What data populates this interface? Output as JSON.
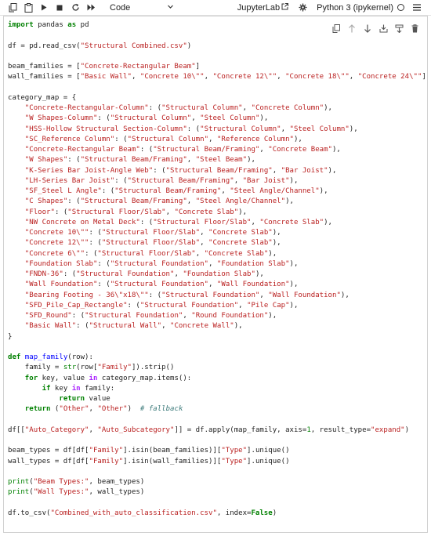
{
  "toolbar": {
    "cell_type": "Code",
    "jupyterlab_link": "JupyterLab",
    "kernel_name": "Python 3 (ipykernel)"
  },
  "icons": {
    "copy": "copy-icon",
    "paste": "paste-icon",
    "run": "run-icon",
    "stop": "stop-icon",
    "restart": "restart-icon",
    "fast_forward": "fast-forward-icon",
    "external": "external-link-icon",
    "settings": "gear-icon",
    "kernel_status": "kernel-idle-circle-icon",
    "menu": "hamburger-menu-icon",
    "cell_copy": "duplicate-cell-icon",
    "move_up": "move-up-icon",
    "move_down": "move-down-icon",
    "insert_below": "insert-below-icon",
    "insert_above": "insert-above-icon",
    "delete": "trash-icon"
  },
  "colors": {
    "keyword": "#008000",
    "string": "#ba2121",
    "function": "#0000ff",
    "operator": "#aa22ff",
    "comment": "#3d7b7b"
  },
  "code": {
    "l1_kw1": "import",
    "l1_mid": " pandas ",
    "l1_kw2": "as",
    "l1_end": " pd",
    "l2_pre": "df = pd.",
    "l2_fn": "read_csv",
    "l2_str": "\"Structural Combined.csv\"",
    "l3_pre": "beam_families = [",
    "l3_str": "\"Concrete-Rectangular Beam\"",
    "l4_pre": "wall_families = [",
    "l4_s1": "\"Basic Wall\"",
    "l4_s2": "\"Concrete 10\\\"\"",
    "l4_s3": "\"Concrete 12\\\"\"",
    "l4_s4": "\"Concrete 18\\\"\"",
    "l4_s5": "\"Concrete 24\\\"\"",
    "l5": "category_map = {",
    "map": [
      [
        "\"Concrete-Rectangular-Column\"",
        "\"Structural Column\"",
        "\"Concrete Column\""
      ],
      [
        "\"W Shapes-Column\"",
        "\"Structural Column\"",
        "\"Steel Column\""
      ],
      [
        "\"HSS-Hollow Structural Section-Column\"",
        "\"Structural Column\"",
        "\"Steel Column\""
      ],
      [
        "\"SC_Reference Column\"",
        "\"Structural Column\"",
        "\"Reference Column\""
      ],
      [
        "\"Concrete-Rectangular Beam\"",
        "\"Structural Beam/Framing\"",
        "\"Concrete Beam\""
      ],
      [
        "\"W Shapes\"",
        "\"Structural Beam/Framing\"",
        "\"Steel Beam\""
      ],
      [
        "\"K-Series Bar Joist-Angle Web\"",
        "\"Structural Beam/Framing\"",
        "\"Bar Joist\""
      ],
      [
        "\"LH-Series Bar Joist\"",
        "\"Structural Beam/Framing\"",
        "\"Bar Joist\""
      ],
      [
        "\"SF_Steel L Angle\"",
        "\"Structural Beam/Framing\"",
        "\"Steel Angle/Channel\""
      ],
      [
        "\"C Shapes\"",
        "\"Structural Beam/Framing\"",
        "\"Steel Angle/Channel\""
      ],
      [
        "\"Floor\"",
        "\"Structural Floor/Slab\"",
        "\"Concrete Slab\""
      ],
      [
        "\"NW Concrete on Metal Deck\"",
        "\"Structural Floor/Slab\"",
        "\"Concrete Slab\""
      ],
      [
        "\"Concrete 10\\\"\"",
        "\"Structural Floor/Slab\"",
        "\"Concrete Slab\""
      ],
      [
        "\"Concrete 12\\\"\"",
        "\"Structural Floor/Slab\"",
        "\"Concrete Slab\""
      ],
      [
        "\"Concrete 6\\\"\"",
        "\"Structural Floor/Slab\"",
        "\"Concrete Slab\""
      ],
      [
        "\"Foundation Slab\"",
        "\"Structural Foundation\"",
        "\"Foundation Slab\""
      ],
      [
        "\"FNDN-36\"",
        "\"Structural Foundation\"",
        "\"Foundation Slab\""
      ],
      [
        "\"Wall Foundation\"",
        "\"Structural Foundation\"",
        "\"Wall Foundation\""
      ],
      [
        "\"Bearing Footing - 36\\\"x18\\\"\"",
        "\"Structural Foundation\"",
        "\"Wall Foundation\""
      ],
      [
        "\"SFD_Pile_Cap_Rectangle\"",
        "\"Structural Foundation\"",
        "\"Pile Cap\""
      ],
      [
        "\"SFD_Round\"",
        "\"Structural Foundation\"",
        "\"Round Foundation\""
      ],
      [
        "\"Basic Wall\"",
        "\"Structural Wall\"",
        "\"Concrete Wall\""
      ]
    ],
    "l_close": "}",
    "def_kw": "def",
    "def_fn": "map_family",
    "def_arg": "(row):",
    "fam_pre": "    family = ",
    "fam_str_fn": "str",
    "fam_mid": "(row[",
    "fam_key": "\"Family\"",
    "fam_end": "]).strip()",
    "for_kw": "for",
    "for_mid": " key, value ",
    "in_kw": "in",
    "for_end": " category_map.items():",
    "if_kw": "if",
    "if_mid": " key ",
    "if_end": " family:",
    "ret_kw": "return",
    "ret1_end": " value",
    "ret2_s1": "\"Other\"",
    "ret2_s2": "\"Other\"",
    "comment": "# fallback",
    "apply_pre": "df[[",
    "apply_s1": "\"Auto_Category\"",
    "apply_s2": "\"Auto_Subcategory\"",
    "apply_mid": "]] = df.apply(map_family, axis=",
    "apply_num": "1",
    "apply_mid2": ", result_type=",
    "apply_s3": "\"expand\"",
    "apply_end": ")",
    "bt_pre": "beam_types = df[df[",
    "bt_s1": "\"Family\"",
    "bt_mid": "].isin(beam_families)][",
    "bt_s2": "\"Type\"",
    "bt_end": "].unique()",
    "wt_pre": "wall_types = df[df[",
    "wt_s1": "\"Family\"",
    "wt_mid": "].isin(wall_families)][",
    "wt_s2": "\"Type\"",
    "wt_end": "].unique()",
    "p1_fn": "print",
    "p1_str": "\"Beam Types:\"",
    "p1_end": ", beam_types)",
    "p2_fn": "print",
    "p2_str": "\"Wall Types:\"",
    "p2_end": ", wall_types)",
    "csv_pre": "df.to_csv(",
    "csv_str": "\"Combined_with_auto_classification.csv\"",
    "csv_mid": ", index=",
    "csv_kw": "False",
    "csv_end": ")"
  }
}
